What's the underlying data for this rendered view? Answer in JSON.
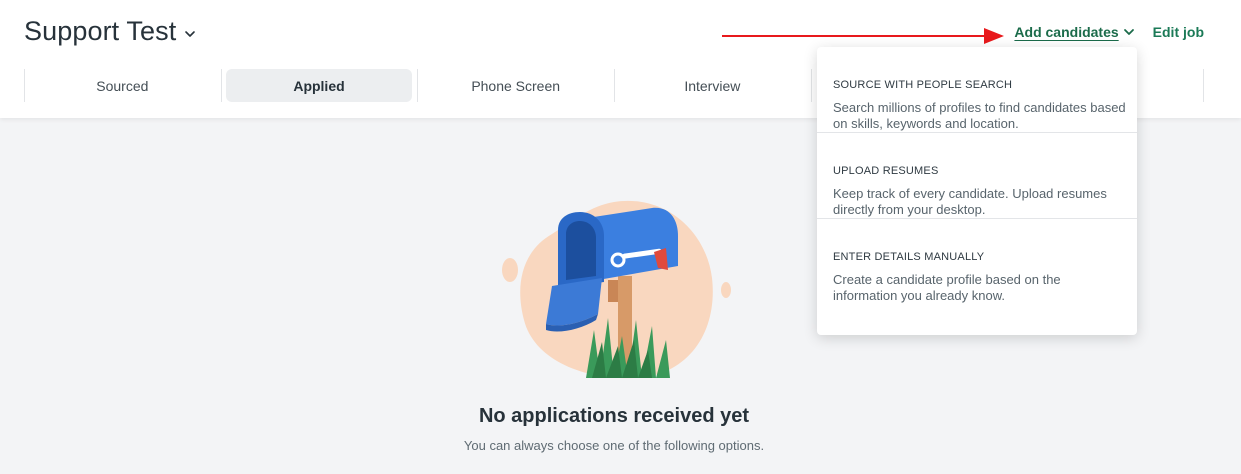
{
  "header": {
    "title": "Support Test",
    "actions": {
      "add_candidates": "Add candidates",
      "edit_job": "Edit job"
    }
  },
  "tabs": [
    {
      "label": "Sourced",
      "active": false
    },
    {
      "label": "Applied",
      "active": true
    },
    {
      "label": "Phone Screen",
      "active": false
    },
    {
      "label": "Interview",
      "active": false
    }
  ],
  "dropdown": {
    "items": [
      {
        "heading": "SOURCE WITH PEOPLE SEARCH",
        "description": "Search millions of profiles to find candidates based on skills, keywords and location."
      },
      {
        "heading": "UPLOAD RESUMES",
        "description": "Keep track of every candidate. Upload resumes directly from your desktop."
      },
      {
        "heading": "ENTER DETAILS MANUALLY",
        "description": "Create a candidate profile based on the information you already know."
      }
    ]
  },
  "empty_state": {
    "title": "No applications received yet",
    "subtitle": "You can always choose one of the following options."
  },
  "colors": {
    "accent": "#1b6b4a",
    "annotation_arrow": "#e8191c",
    "background": "#f3f4f6"
  },
  "icons": [
    "chevron-down-icon",
    "mailbox-illustration",
    "red-arrow-annotation"
  ]
}
